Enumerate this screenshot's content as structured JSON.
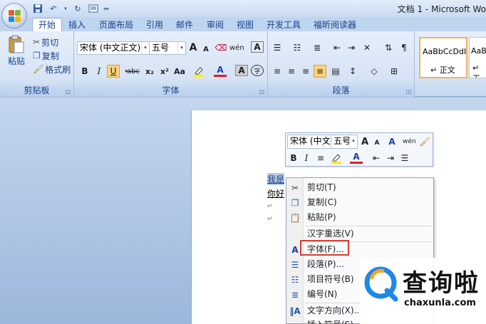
{
  "window": {
    "title": "文档 1 - Microsoft Wo"
  },
  "tabs": [
    "开始",
    "插入",
    "页面布局",
    "引用",
    "邮件",
    "审阅",
    "视图",
    "开发工具",
    "福昕阅读器"
  ],
  "clipboard": {
    "paste": "粘贴",
    "cut": "剪切",
    "copy": "复制",
    "format_painter": "格式刷",
    "group_label": "剪贴板"
  },
  "font": {
    "name": "宋体 (中文正文)",
    "size": "五号",
    "group_label": "字体",
    "bold": "B",
    "italic": "I",
    "underline": "U",
    "strike": "abc",
    "sub": "x₂",
    "sup": "x²",
    "case": "Aa",
    "grow": "A",
    "shrink": "A",
    "wen": "wén",
    "clear": "A",
    "border_a": "A",
    "circle": "字"
  },
  "paragraph": {
    "group_label": "段落"
  },
  "styles": [
    {
      "preview": "AaBbCcDdI",
      "name": "↵ 正文"
    },
    {
      "preview": "AaBb",
      "name": "↵ 无"
    }
  ],
  "document": {
    "line1": "我是",
    "line1_sel": "我是",
    "line2": "你好"
  },
  "minibar": {
    "font": "宋体 (中⽂",
    "size": "五号",
    "bold": "B",
    "italic": "I",
    "wen": "wén"
  },
  "context_menu": {
    "items": [
      {
        "label": "剪切(T)",
        "icon": "scissors-icon"
      },
      {
        "label": "复制(C)",
        "icon": "copy-icon"
      },
      {
        "label": "粘贴(P)",
        "icon": "paste-icon"
      },
      {
        "label": "汉字重选(V)",
        "icon": ""
      },
      {
        "label": "字体(F)...",
        "icon": "font-icon"
      },
      {
        "label": "段落(P)...",
        "icon": "paragraph-icon"
      },
      {
        "label": "项目符号(B)",
        "icon": "bullets-icon"
      },
      {
        "label": "编号(N)",
        "icon": "numbering-icon"
      },
      {
        "label": "文字方向(X)...",
        "icon": "text-direction-icon"
      },
      {
        "label": "插入符号(S)",
        "icon": ""
      }
    ]
  },
  "watermark": {
    "name": "查询啦",
    "url": "chaxunla.com"
  },
  "colors": {
    "accent": "#15428b",
    "highlight_box": "#e03b32",
    "watermark_blue": "#1e88e5"
  }
}
